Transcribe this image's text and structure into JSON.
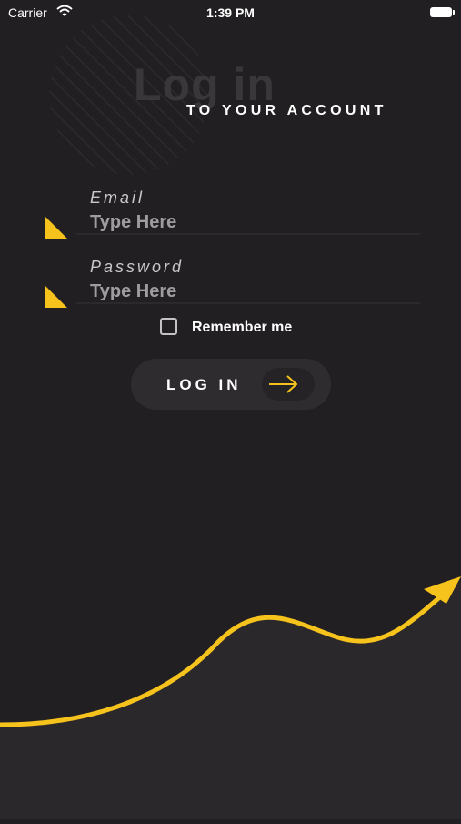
{
  "status_bar": {
    "carrier": "Carrier",
    "time": "1:39 PM"
  },
  "header": {
    "title": "Log in",
    "subtitle": "TO YOUR ACCOUNT"
  },
  "form": {
    "email": {
      "label": "Email",
      "placeholder": "Type Here"
    },
    "password": {
      "label": "Password",
      "placeholder": "Type Here"
    },
    "remember_label": "Remember me",
    "remember_checked": false,
    "submit_label": "LOG IN"
  },
  "colors": {
    "background": "#221f22",
    "accent": "#f6c21c",
    "button": "#2f2c2f",
    "lower_area": "#2b282b"
  },
  "icons": {
    "wifi": "wifi-icon",
    "battery": "battery-icon",
    "arrow": "arrow-right-icon",
    "field_marker": "triangle-marker-icon"
  }
}
